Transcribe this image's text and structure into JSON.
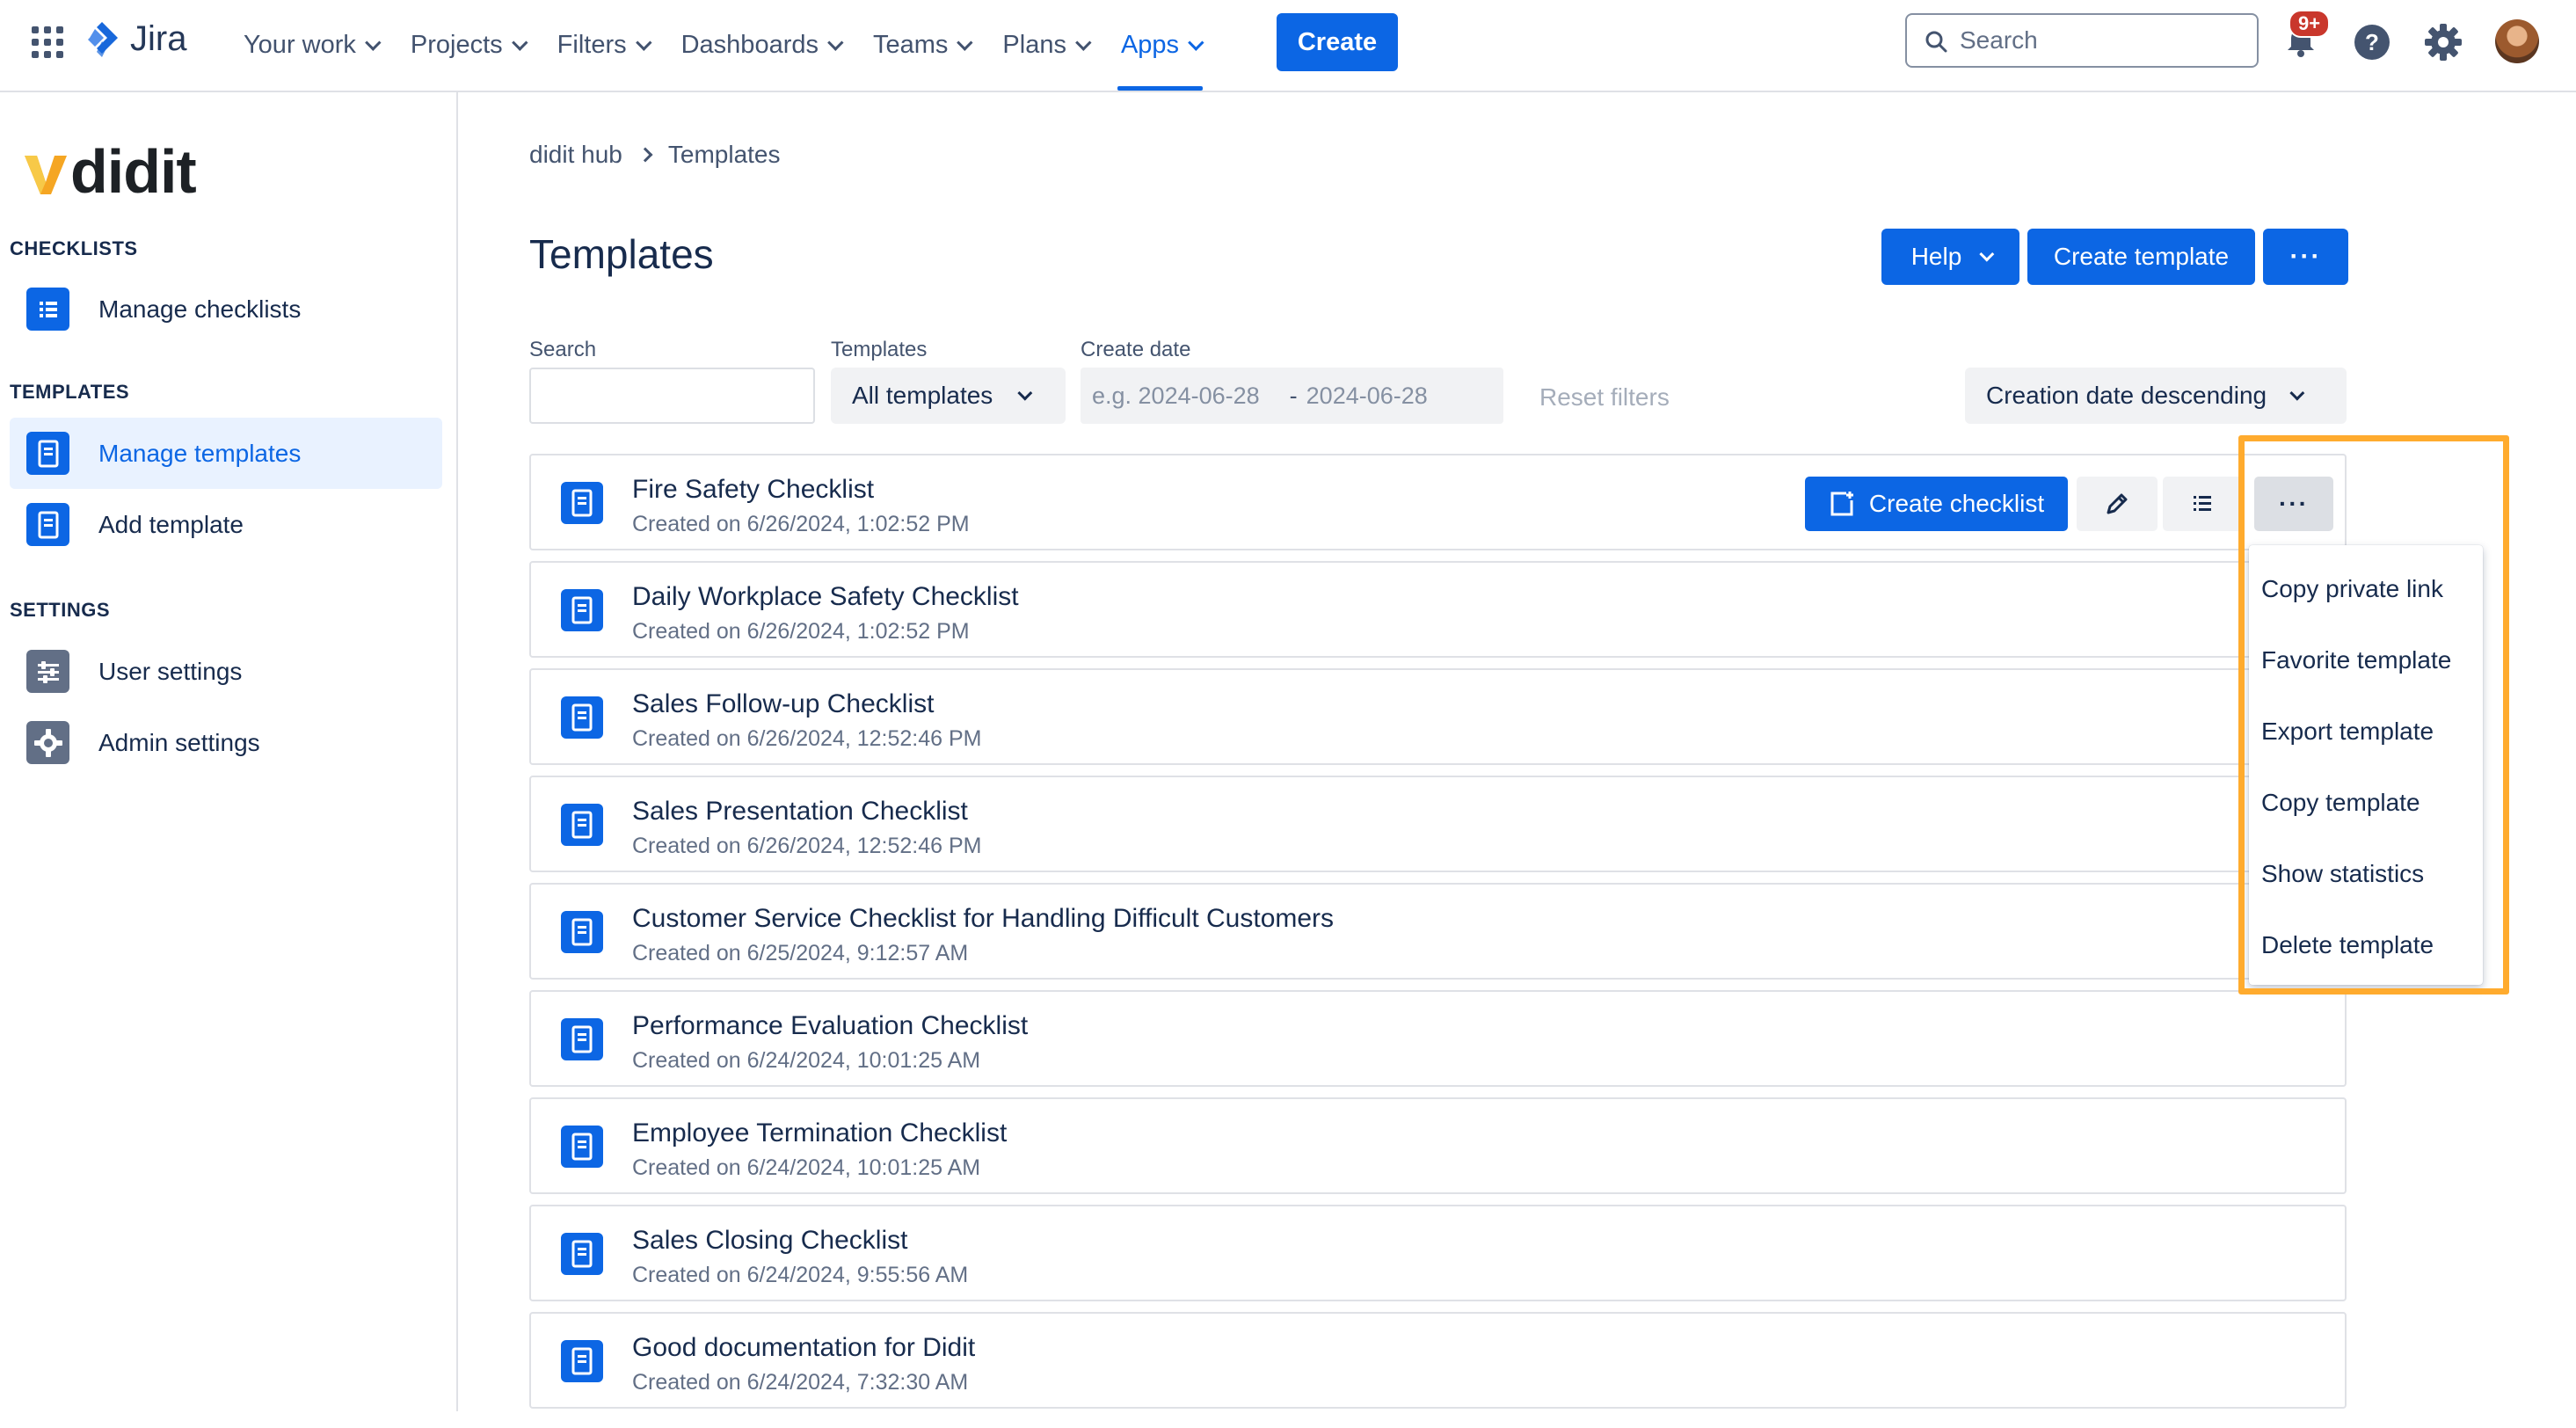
{
  "topnav": {
    "product": "Jira",
    "items": [
      {
        "label": "Your work"
      },
      {
        "label": "Projects"
      },
      {
        "label": "Filters"
      },
      {
        "label": "Dashboards"
      },
      {
        "label": "Teams"
      },
      {
        "label": "Plans"
      },
      {
        "label": "Apps",
        "active": true
      }
    ],
    "create_label": "Create",
    "search_placeholder": "Search",
    "notification_badge": "9+"
  },
  "sidebar": {
    "brand": "didit",
    "sections": [
      {
        "heading": "CHECKLISTS",
        "items": [
          {
            "label": "Manage checklists",
            "icon": "list-icon"
          }
        ]
      },
      {
        "heading": "TEMPLATES",
        "items": [
          {
            "label": "Manage templates",
            "icon": "template-icon",
            "selected": true
          },
          {
            "label": "Add template",
            "icon": "template-icon"
          }
        ]
      },
      {
        "heading": "SETTINGS",
        "items": [
          {
            "label": "User settings",
            "icon": "sliders-icon"
          },
          {
            "label": "Admin settings",
            "icon": "gear-icon"
          }
        ]
      }
    ]
  },
  "breadcrumb": [
    "didit hub",
    "Templates"
  ],
  "page": {
    "title": "Templates",
    "help_label": "Help",
    "create_template_label": "Create template",
    "more_label": "···"
  },
  "filters": {
    "search_label": "Search",
    "search_value": "",
    "templates_label": "Templates",
    "templates_value": "All templates",
    "date_label": "Create date",
    "date_from_placeholder": "e.g. 2024-06-28",
    "date_to_placeholder": "2024-06-28",
    "date_separator": "-",
    "reset_label": "Reset filters",
    "sort_value": "Creation date descending"
  },
  "templates": [
    {
      "title": "Fire Safety Checklist",
      "created": "Created on 6/26/2024, 1:02:52 PM"
    },
    {
      "title": "Daily Workplace Safety Checklist",
      "created": "Created on 6/26/2024, 1:02:52 PM"
    },
    {
      "title": "Sales Follow-up Checklist",
      "created": "Created on 6/26/2024, 12:52:46 PM"
    },
    {
      "title": "Sales Presentation Checklist",
      "created": "Created on 6/26/2024, 12:52:46 PM"
    },
    {
      "title": "Customer Service Checklist for Handling Difficult Customers",
      "created": "Created on 6/25/2024, 9:12:57 AM"
    },
    {
      "title": "Performance Evaluation Checklist",
      "created": "Created on 6/24/2024, 10:01:25 AM"
    },
    {
      "title": "Employee Termination Checklist",
      "created": "Created on 6/24/2024, 10:01:25 AM"
    },
    {
      "title": "Sales Closing Checklist",
      "created": "Created on 6/24/2024, 9:55:56 AM"
    },
    {
      "title": "Good documentation for Didit",
      "created": "Created on 6/24/2024, 7:32:30 AM"
    }
  ],
  "row_actions": {
    "create_checklist_label": "Create checklist",
    "more_label": "···"
  },
  "dropdown_menu": [
    "Copy private link",
    "Favorite template",
    "Export template",
    "Copy template",
    "Show statistics",
    "Delete template"
  ],
  "colors": {
    "accent": "#0c66e4",
    "highlight": "#ffab2e",
    "badge": "#c9372c"
  }
}
